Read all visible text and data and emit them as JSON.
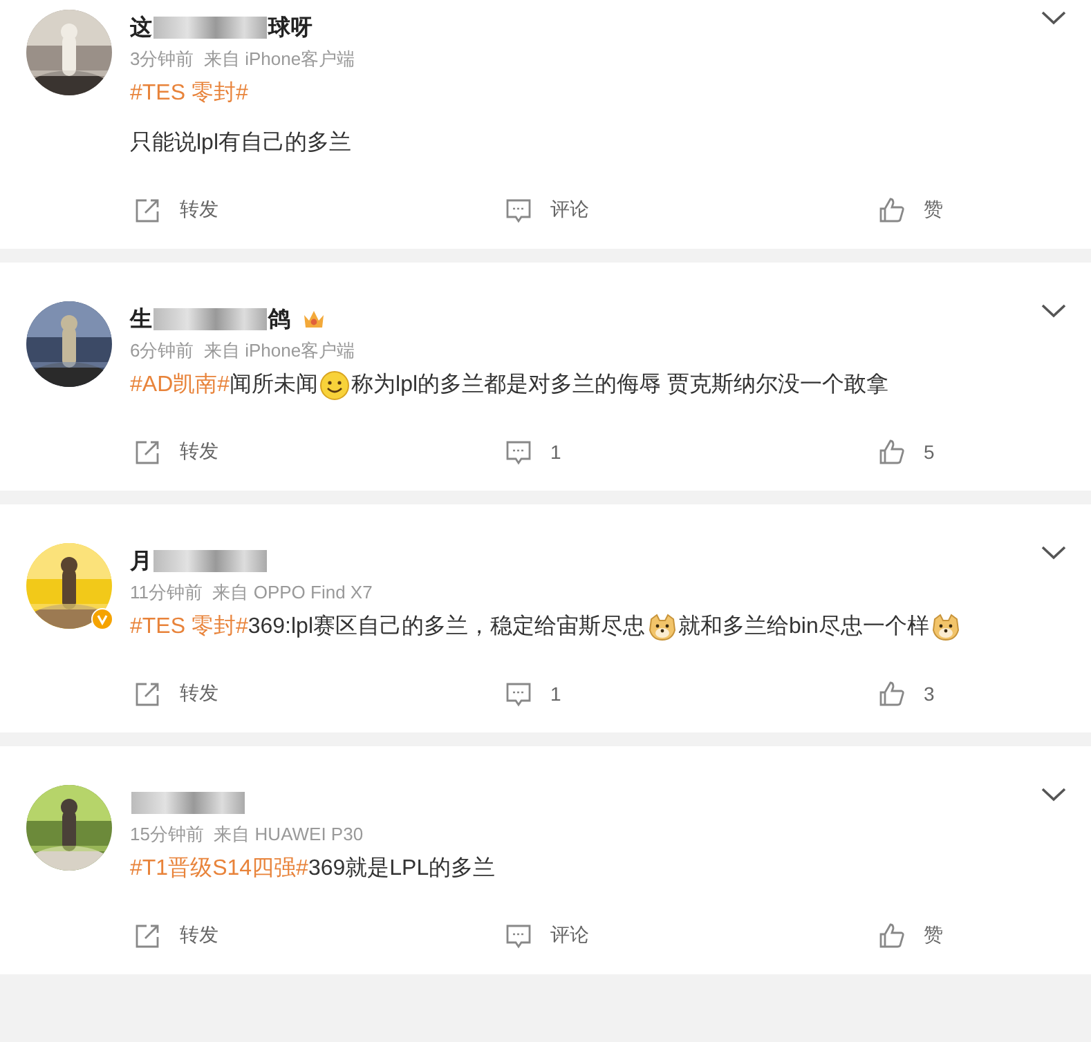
{
  "posts": [
    {
      "name_parts": [
        {
          "kind": "text",
          "text": "这"
        },
        {
          "kind": "blur"
        },
        {
          "kind": "text",
          "text": "球呀"
        }
      ],
      "crown_badge": false,
      "verified": false,
      "meta": "3分钟前  来自 iPhone客户端",
      "content": [
        {
          "kind": "topic",
          "text": "#TES 零封#"
        },
        {
          "kind": "break"
        },
        {
          "kind": "text",
          "text": "只能说lpl有自己的多兰"
        }
      ],
      "repost": "转发",
      "comment": "评论",
      "like": "赞"
    },
    {
      "name_parts": [
        {
          "kind": "text",
          "text": "生"
        },
        {
          "kind": "blur"
        },
        {
          "kind": "text",
          "text": "鸽"
        }
      ],
      "crown_badge": true,
      "verified": false,
      "meta": "6分钟前  来自 iPhone客户端",
      "content": [
        {
          "kind": "topic",
          "text": "#AD凯南#"
        },
        {
          "kind": "text",
          "text": "闻所未闻"
        },
        {
          "kind": "smile"
        },
        {
          "kind": "text",
          "text": "称为lpl的多兰都是对多兰的侮辱 贾克斯纳尔没一个敢拿"
        }
      ],
      "repost": "转发",
      "comment": "1",
      "like": "5"
    },
    {
      "name_parts": [
        {
          "kind": "text",
          "text": "月"
        },
        {
          "kind": "blur"
        }
      ],
      "crown_badge": false,
      "verified": true,
      "meta": "11分钟前  来自 OPPO Find X7",
      "content": [
        {
          "kind": "topic",
          "text": "#TES 零封#"
        },
        {
          "kind": "text",
          "text": "369:lpl赛区自己的多兰，稳定给宙斯尽忠"
        },
        {
          "kind": "dog"
        },
        {
          "kind": "text",
          "text": "就和多兰给bin尽忠一个样"
        },
        {
          "kind": "dog"
        }
      ],
      "repost": "转发",
      "comment": "1",
      "like": "3"
    },
    {
      "name_parts": [
        {
          "kind": "blur"
        }
      ],
      "crown_badge": false,
      "verified": false,
      "meta": "15分钟前  来自 HUAWEI P30",
      "content": [
        {
          "kind": "topic",
          "text": "#T1晋级S14四强#"
        },
        {
          "kind": "text",
          "text": "369就是LPL的多兰"
        }
      ],
      "repost": "转发",
      "comment": "评论",
      "like": "赞"
    }
  ]
}
